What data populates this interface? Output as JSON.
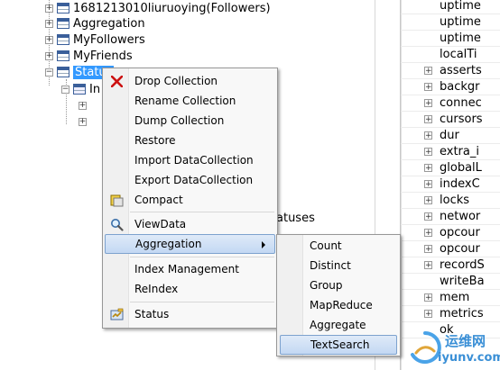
{
  "tree": {
    "nodes": [
      {
        "label": "1681213010liuruoying(Followers)"
      },
      {
        "label": "Aggregation"
      },
      {
        "label": "MyFollowers"
      },
      {
        "label": "MyFriends"
      },
      {
        "label": "Status"
      },
      {
        "label": "In"
      }
    ],
    "behind_text": "atuses"
  },
  "right_panel": {
    "rows": [
      {
        "label": "uptime",
        "expandable": false
      },
      {
        "label": "uptime",
        "expandable": false
      },
      {
        "label": "uptime",
        "expandable": false
      },
      {
        "label": "localTi",
        "expandable": false
      },
      {
        "label": "asserts",
        "expandable": true
      },
      {
        "label": "backgr",
        "expandable": true
      },
      {
        "label": "connec",
        "expandable": true
      },
      {
        "label": "cursors",
        "expandable": true
      },
      {
        "label": "dur",
        "expandable": true
      },
      {
        "label": "extra_i",
        "expandable": true
      },
      {
        "label": "globalL",
        "expandable": true
      },
      {
        "label": "indexC",
        "expandable": true
      },
      {
        "label": "locks",
        "expandable": true
      },
      {
        "label": "networ",
        "expandable": true
      },
      {
        "label": "opcour",
        "expandable": true
      },
      {
        "label": "opcour",
        "expandable": true
      },
      {
        "label": "recordS",
        "expandable": true
      },
      {
        "label": "writeBa",
        "expandable": false
      },
      {
        "label": "mem",
        "expandable": true
      },
      {
        "label": "metrics",
        "expandable": true
      },
      {
        "label": "ok",
        "expandable": false
      }
    ]
  },
  "context_menu": {
    "group1": [
      "Drop Collection",
      "Rename Collection",
      "Dump Collection",
      "Restore",
      "Import DataCollection",
      "Export DataCollection",
      "Compact"
    ],
    "group2": [
      "ViewData",
      "Aggregation"
    ],
    "group3": [
      "Index Management",
      "ReIndex"
    ],
    "group4": [
      "Status"
    ],
    "highlighted": "Aggregation"
  },
  "submenu": {
    "items": [
      "Count",
      "Distinct",
      "Group",
      "MapReduce",
      "Aggregate",
      "TextSearch"
    ],
    "highlighted": "TextSearch"
  },
  "watermark": {
    "cn_text": "运维网",
    "url_text": "iyunv.com",
    "color": "#3a8fd6"
  },
  "colors": {
    "selection": "#3399ff",
    "menu_highlight": "#c3d8f3",
    "drop_icon": "#cc1111"
  }
}
